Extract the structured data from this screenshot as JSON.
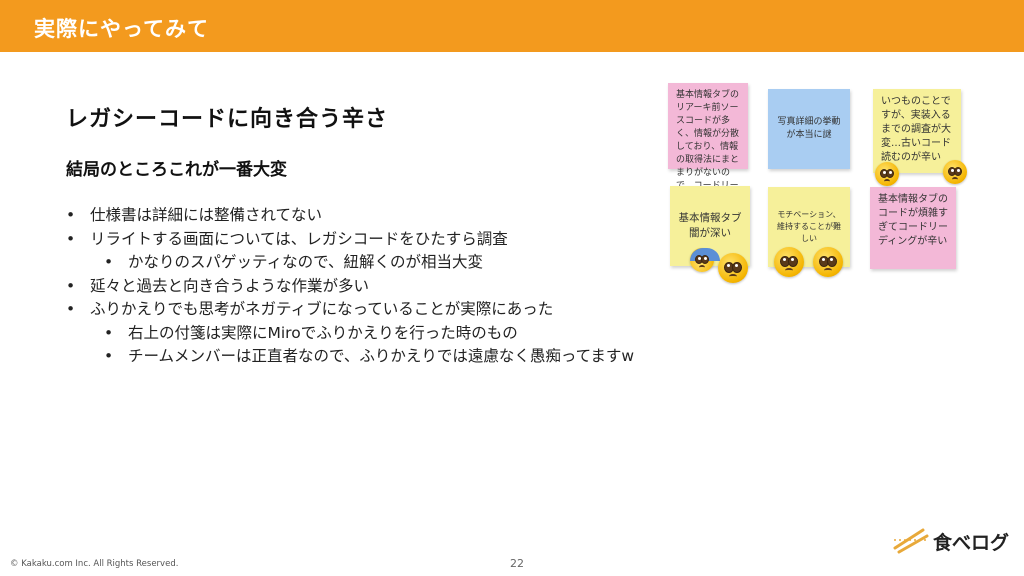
{
  "header": {
    "title": "実際にやってみて"
  },
  "slide": {
    "title": "レガシーコードに向き合う辛さ",
    "subtitle": "結局のところこれが一番大変",
    "bullets": [
      {
        "level": 1,
        "text": "仕様書は詳細には整備されてない"
      },
      {
        "level": 1,
        "text": "リライトする画面については、レガシコードをひたすら調査"
      },
      {
        "level": 2,
        "text": "かなりのスパゲッティなので、紐解くのが相当大変"
      },
      {
        "level": 1,
        "text": "延々と過去と向き合うような作業が多い"
      },
      {
        "level": 1,
        "text": "ふりかえりでも思考がネガティブになっていることが実際にあった"
      },
      {
        "level": 2,
        "text": "右上の付箋は実際にMiroでふりかえりを行った時のもの"
      },
      {
        "level": 2,
        "text": "チームメンバーは正直者なので、ふりかえりでは遠慮なく愚痴ってますw"
      }
    ]
  },
  "sticky_notes": [
    {
      "color": "pink",
      "text": "基本情報タブのリアーキ前ソースコードが多く、情報が分散しており、情報の取得法にまとまりがないので、コードリーディングが辛い"
    },
    {
      "color": "blue",
      "text": "写真詳細の挙動が本当に謎"
    },
    {
      "color": "yellow",
      "text": "いつものことですが、実装入るまでの調査が大変…古いコード読むのが辛い"
    },
    {
      "color": "yellow",
      "text": "基本情報タブ闇が深い"
    },
    {
      "color": "yellow",
      "text": "モチベーション、維持することが難しい"
    },
    {
      "color": "pink",
      "text": "基本情報タブのコードが煩雑すぎてコードリーディングが辛い"
    }
  ],
  "emojis": [
    "pleading-face",
    "pleading-face",
    "fearful-face",
    "pleading-face",
    "pleading-face",
    "pleading-face"
  ],
  "footer": {
    "copyright": "© Kakaku.com Inc. All Rights Reserved.",
    "page_number": "22",
    "logo_text": "食べログ"
  },
  "colors": {
    "header_bar": "#f39a1e",
    "note_pink": "#f3b8d7",
    "note_blue": "#a9cdf2",
    "note_yellow": "#f6f09a"
  }
}
